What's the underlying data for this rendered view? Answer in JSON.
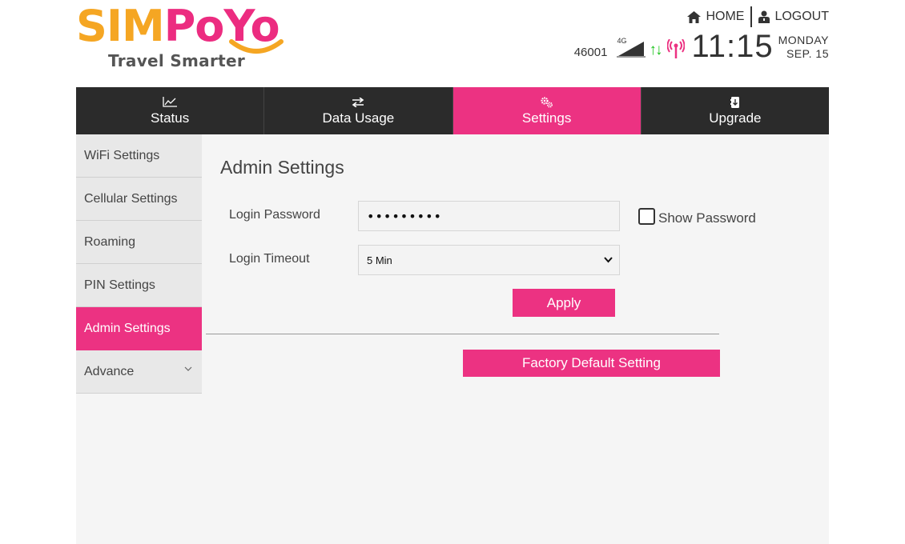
{
  "brand": {
    "name_part1": "SIM",
    "name_part2": "PoYo",
    "tagline": "Travel Smarter",
    "color_primary": "#ec3282",
    "color_secondary": "#f5a623"
  },
  "header": {
    "home_label": "HOME",
    "logout_label": "LOGOUT",
    "carrier": "46001",
    "network_type": "4G",
    "time": "11:15",
    "day": "MONDAY",
    "date": "SEP. 15"
  },
  "nav": {
    "tabs": [
      {
        "label": "Status",
        "icon": "chart-icon"
      },
      {
        "label": "Data Usage",
        "icon": "transfer-icon"
      },
      {
        "label": "Settings",
        "icon": "gears-icon",
        "active": true
      },
      {
        "label": "Upgrade",
        "icon": "upgrade-icon"
      }
    ]
  },
  "sidebar": {
    "items": [
      {
        "label": "WiFi Settings"
      },
      {
        "label": "Cellular Settings"
      },
      {
        "label": "Roaming"
      },
      {
        "label": "PIN Settings"
      },
      {
        "label": "Admin Settings",
        "active": true
      },
      {
        "label": "Advance",
        "expandable": true
      }
    ]
  },
  "main": {
    "title": "Admin Settings",
    "login_password_label": "Login Password",
    "login_password_value": "•••••••••",
    "show_password_label": "Show Password",
    "login_timeout_label": "Login Timeout",
    "login_timeout_value": "5 Min",
    "apply_label": "Apply",
    "factory_default_label": "Factory Default Setting"
  }
}
